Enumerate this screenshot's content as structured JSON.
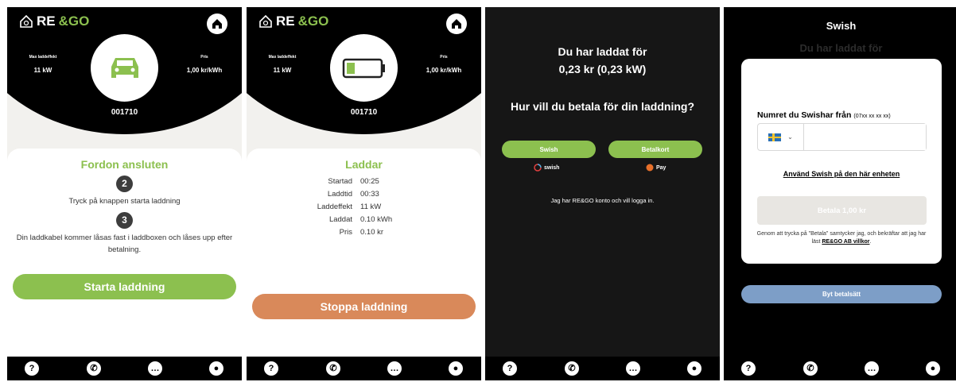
{
  "brand": {
    "logo_text_a": "RE",
    "logo_text_b": "&GO"
  },
  "stats": {
    "max_label": "Max laddeffekt",
    "max_value": "11 kW",
    "price_label": "Pris",
    "price_value": "1,00 kr/kWh"
  },
  "station_id": "001710",
  "screen1": {
    "title": "Fordon ansluten",
    "step2_num": "2",
    "step2_text": "Tryck på knappen starta laddning",
    "step3_num": "3",
    "step3_text": "Din laddkabel kommer låsas fast i laddboxen och låses upp efter betalning.",
    "start_button": "Starta laddning"
  },
  "screen2": {
    "title": "Laddar",
    "rows": [
      {
        "label": "Startad",
        "value": "00:25"
      },
      {
        "label": "Laddtid",
        "value": "00:33"
      },
      {
        "label": "Laddeffekt",
        "value": "11 kW"
      },
      {
        "label": "Laddat",
        "value": "0.10 kWh"
      },
      {
        "label": "Pris",
        "value": "0.10 kr"
      }
    ],
    "stop_button": "Stoppa laddning",
    "battery_level": 0.25
  },
  "screen3": {
    "paid_line1": "Du har laddat för",
    "paid_line2": "0,23 kr (0,23 kW)",
    "question": "Hur vill du betala för din laddning?",
    "swish_button": "Swish",
    "card_button": "Betalkort",
    "swish_brand": "swish",
    "pay_brand": "Pay",
    "login_link": "Jag har RE&GO konto och vill logga in."
  },
  "screen4": {
    "title": "Swish",
    "ghost_title": "Du har laddat för",
    "number_label": "Numret du Swishar från",
    "number_hint": "(07xx xx xx xx)",
    "phone_value": "",
    "device_link": "Använd Swish på den här enheten",
    "pay_button": "Betala 1,00 kr",
    "terms_text": "Genom att trycka på \"Betala\" samtycker jag, och bekräftar att jag har läst",
    "terms_link": "RE&GO AB villkor",
    "terms_end": ".",
    "change_button": "Byt betalsätt"
  },
  "nav": {
    "help": "?",
    "phone": "✆",
    "chat": "…",
    "profile": "●"
  },
  "colors": {
    "green": "#8cc04f",
    "orange": "#d9895a",
    "blue": "#7d9ec7",
    "dark": "#000000"
  }
}
